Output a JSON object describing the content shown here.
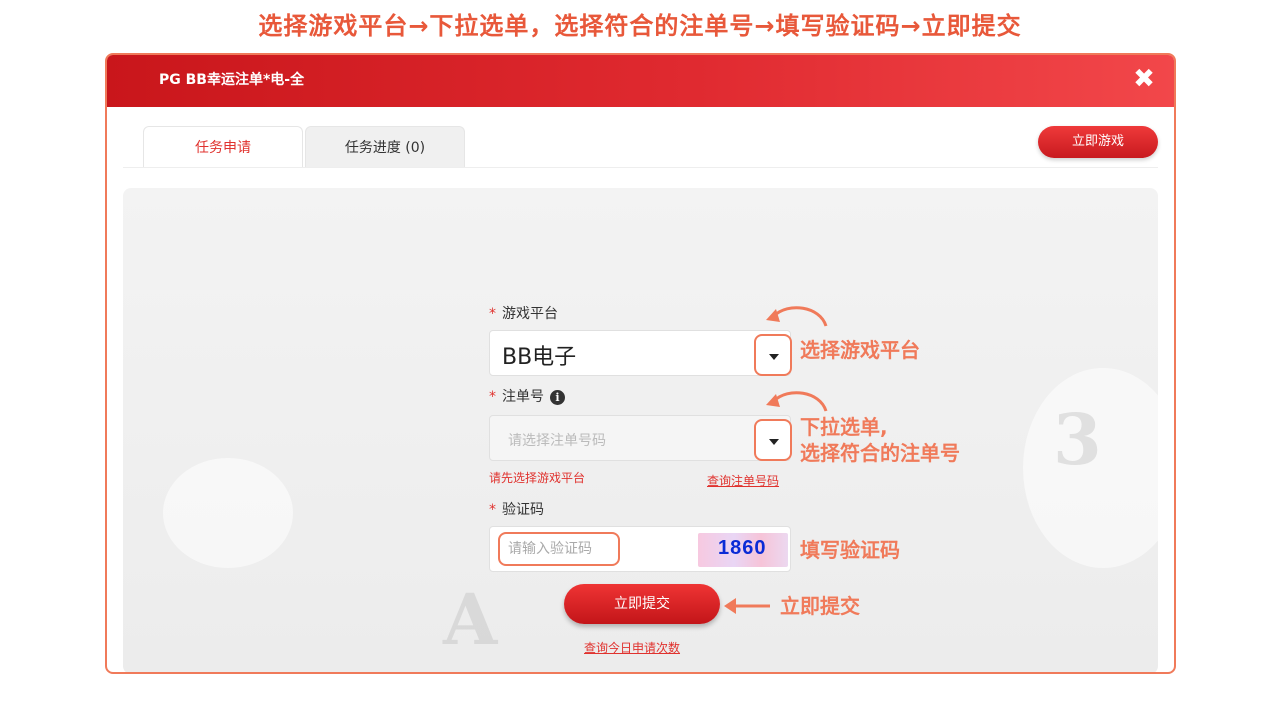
{
  "banner": {
    "text": "选择游戏平台→下拉选单，选择符合的注单号→填写验证码→立即提交"
  },
  "modal": {
    "title": "PG BB幸运注单*电-全",
    "close_icon": "close-icon",
    "tabs": [
      {
        "label": "任务申请",
        "active": true
      },
      {
        "label": "任务进度 (0)",
        "active": false
      }
    ],
    "play_button": "立即游戏"
  },
  "form": {
    "platform": {
      "required_mark": "*",
      "label": "游戏平台",
      "value": "BB电子"
    },
    "ticket": {
      "required_mark": "*",
      "label": "注单号",
      "info_icon": "info-icon",
      "placeholder": "请选择注单号码",
      "error": "请先选择游戏平台",
      "query_link": "查询注单号码"
    },
    "captcha": {
      "required_mark": "*",
      "label": "验证码",
      "placeholder": "请输入验证码",
      "code": "1860"
    },
    "submit": "立即提交",
    "daily_query_link": "查询今日申请次数"
  },
  "annotations": {
    "select_platform": "选择游戏平台",
    "select_ticket_line1": "下拉选单,",
    "select_ticket_line2": "选择符合的注单号",
    "fill_captcha": "填写验证码",
    "submit_now": "立即提交"
  },
  "colors": {
    "accent": "#e0322e",
    "annotation": "#f07a5a",
    "header_start": "#c9161b",
    "header_end": "#f2474a"
  }
}
